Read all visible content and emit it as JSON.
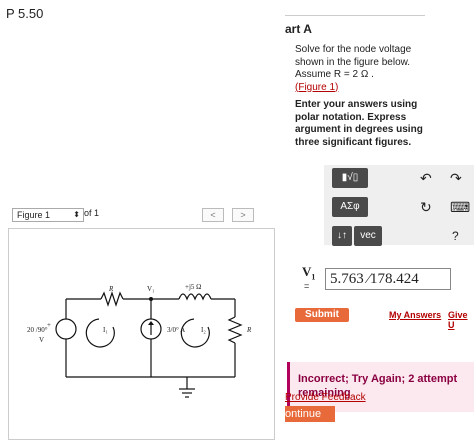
{
  "problem_title": "P 5.50",
  "part_label": "art A",
  "instructions": {
    "line1": "Solve for the node voltage",
    "line2": "shown in the figure below.",
    "line3": "Assume R = 2 Ω .",
    "figure_link": "(Figure 1)"
  },
  "enter_answers": {
    "line1": "Enter your answers using",
    "line2": "polar notation. Express",
    "line3": "argument in degrees using",
    "line4": "three significant figures."
  },
  "toolbar": {
    "templates_label": "▮√▯",
    "greek_label": "AΣφ",
    "vector_label": "vec",
    "sort_label": "↓↑",
    "undo_label": "↶",
    "redo_label": "↷",
    "reset_label": "↻",
    "keyboard_label": "⌨",
    "help_label": "?"
  },
  "answer": {
    "var_label": "V",
    "var_sub": "1",
    "equals": "=",
    "value": "5.763 ∕178.424"
  },
  "submit_label": "Submit",
  "my_answers_label": "My Answers",
  "give_up_label": "Give U",
  "feedback": {
    "line1": "Incorrect; Try Again; 2 attempt",
    "line2": "remaining"
  },
  "provide_feedback_label": "Provide Feedback",
  "continue_label": "ontinue",
  "figure_nav": {
    "selector_value": "Figure 1",
    "of_text": "of 1",
    "prev_label": "<",
    "next_label": ">"
  },
  "circuit": {
    "source_label": "20 /90°",
    "source_unit": "V",
    "r_top_label": "R",
    "v1_label": "V₁",
    "inductor_label": "+j5 Ω",
    "r_right_label": "R",
    "mesh1_label": "I₁",
    "mesh2_label": "I₂",
    "current_source_label": "3/0°  A"
  },
  "colors": {
    "accent_orange": "#e8693a",
    "link_red": "#b30000",
    "incorrect_bg": "#fbe9ef",
    "incorrect_text": "#8b0040",
    "toolbar_dark": "#4a4a4a"
  }
}
